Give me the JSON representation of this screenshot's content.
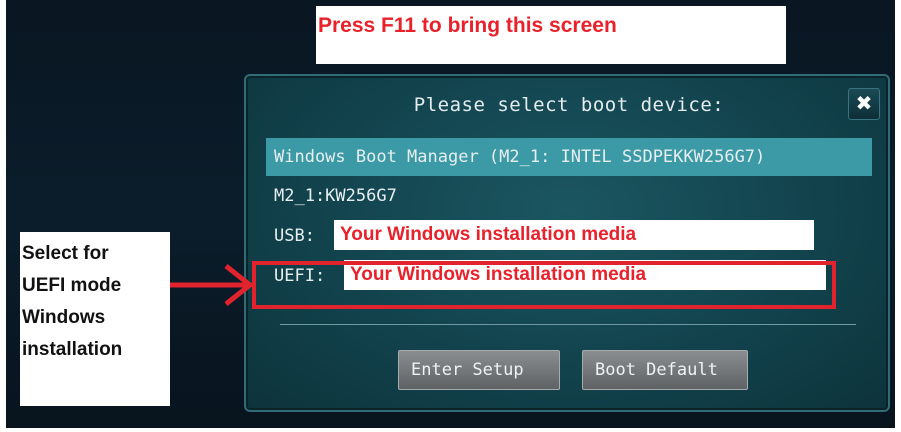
{
  "callouts": {
    "top": "Press F11 to bring this screen",
    "left_lines": [
      "Select for",
      "UEFI mode",
      "Windows",
      "installation"
    ]
  },
  "dialog": {
    "title": "Please select boot device:",
    "close_glyph": "✖",
    "items": [
      {
        "label": "Windows Boot Manager (M2_1: INTEL SSDPEKKW256G7)",
        "selected": true
      },
      {
        "label": "M2_1:KW256G7",
        "selected": false
      },
      {
        "prefix": "USB:",
        "media": "Your Windows installation media",
        "selected": false
      },
      {
        "prefix": "UEFI:",
        "media": "Your Windows installation media",
        "selected": false,
        "highlighted": true
      }
    ],
    "buttons": {
      "setup": "Enter Setup",
      "default": "Boot Default"
    }
  },
  "colors": {
    "accent_red": "#e8212b",
    "selection": "#3c9aa6",
    "dialog_bg": "#12434d"
  },
  "icons": {
    "close": "close-icon",
    "arrow": "arrow-right-icon"
  }
}
